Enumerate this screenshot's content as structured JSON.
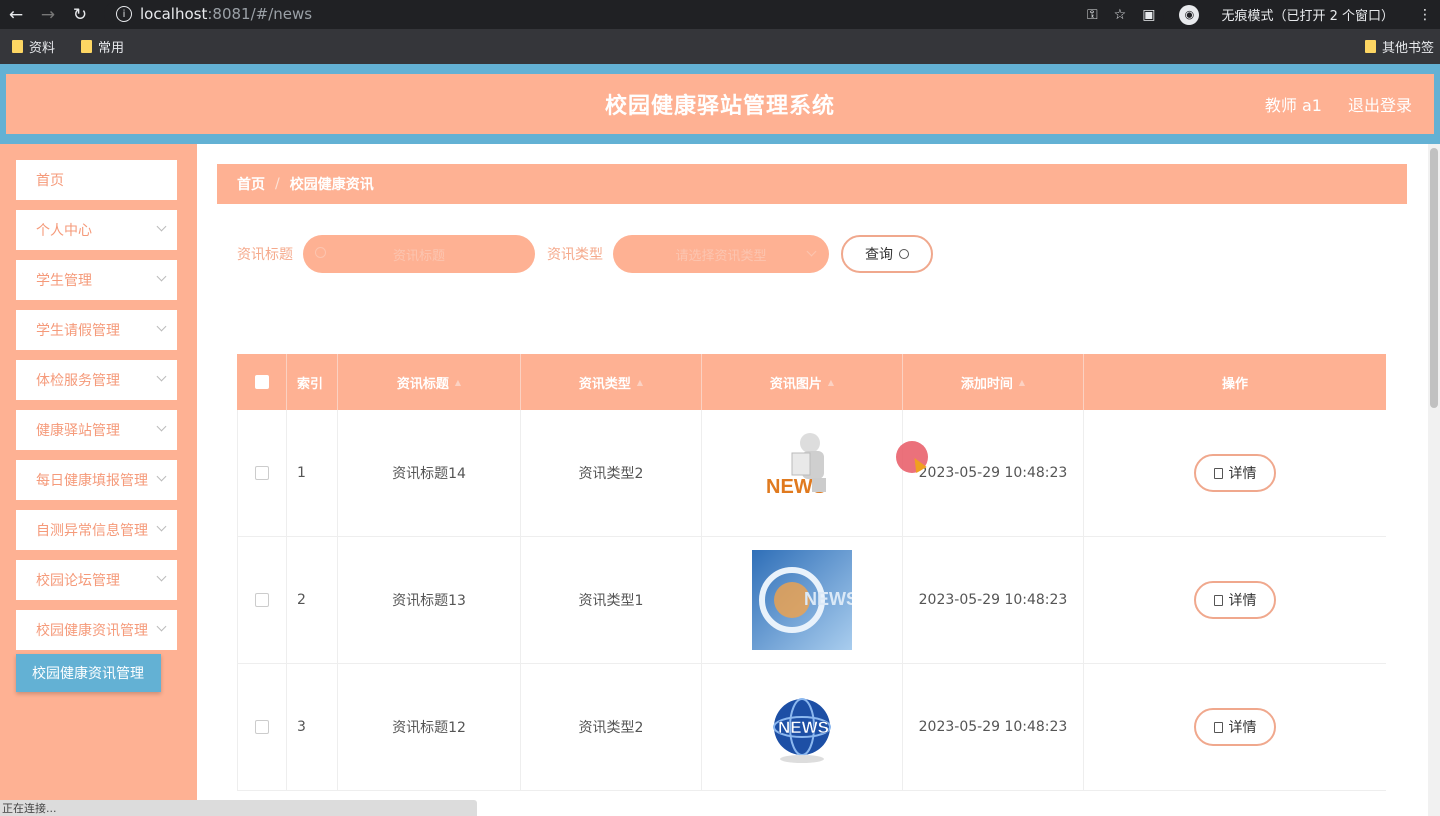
{
  "browser": {
    "url_host": "localhost",
    "url_rest": ":8081/#/news",
    "incognito_label": "无痕模式（已打开 2 个窗口）",
    "bookmarks": [
      "资料",
      "常用"
    ],
    "other_bookmarks": "其他书签",
    "status_text": "正在连接..."
  },
  "header": {
    "title": "校园健康驿站管理系统",
    "user": "教师 a1",
    "logout": "退出登录"
  },
  "sidebar": {
    "items": [
      {
        "label": "首页"
      },
      {
        "label": "个人中心"
      },
      {
        "label": "学生管理"
      },
      {
        "label": "学生请假管理"
      },
      {
        "label": "体检服务管理"
      },
      {
        "label": "健康驿站管理"
      },
      {
        "label": "每日健康填报管理"
      },
      {
        "label": "自测异常信息管理"
      },
      {
        "label": "校园论坛管理"
      },
      {
        "label": "校园健康资讯管理"
      }
    ],
    "active_sub": "校园健康资讯管理"
  },
  "breadcrumb": {
    "home": "首页",
    "current": "校园健康资讯"
  },
  "search": {
    "title_label": "资讯标题",
    "title_placeholder": "资讯标题",
    "type_label": "资讯类型",
    "type_placeholder": "请选择资讯类型",
    "query_button": "查询"
  },
  "table": {
    "headers": [
      "索引",
      "资讯标题",
      "资讯类型",
      "资讯图片",
      "添加时间",
      "操作"
    ],
    "detail_label": "详情",
    "rows": [
      {
        "index": "1",
        "title": "资讯标题14",
        "type": "资讯类型2",
        "time": "2023-05-29 10:48:23"
      },
      {
        "index": "2",
        "title": "资讯标题13",
        "type": "资讯类型1",
        "time": "2023-05-29 10:48:23"
      },
      {
        "index": "3",
        "title": "资讯标题12",
        "type": "资讯类型2",
        "time": "2023-05-29 10:48:23"
      }
    ]
  },
  "colors": {
    "accent": "#feb193",
    "header_border": "#63b1d4"
  }
}
